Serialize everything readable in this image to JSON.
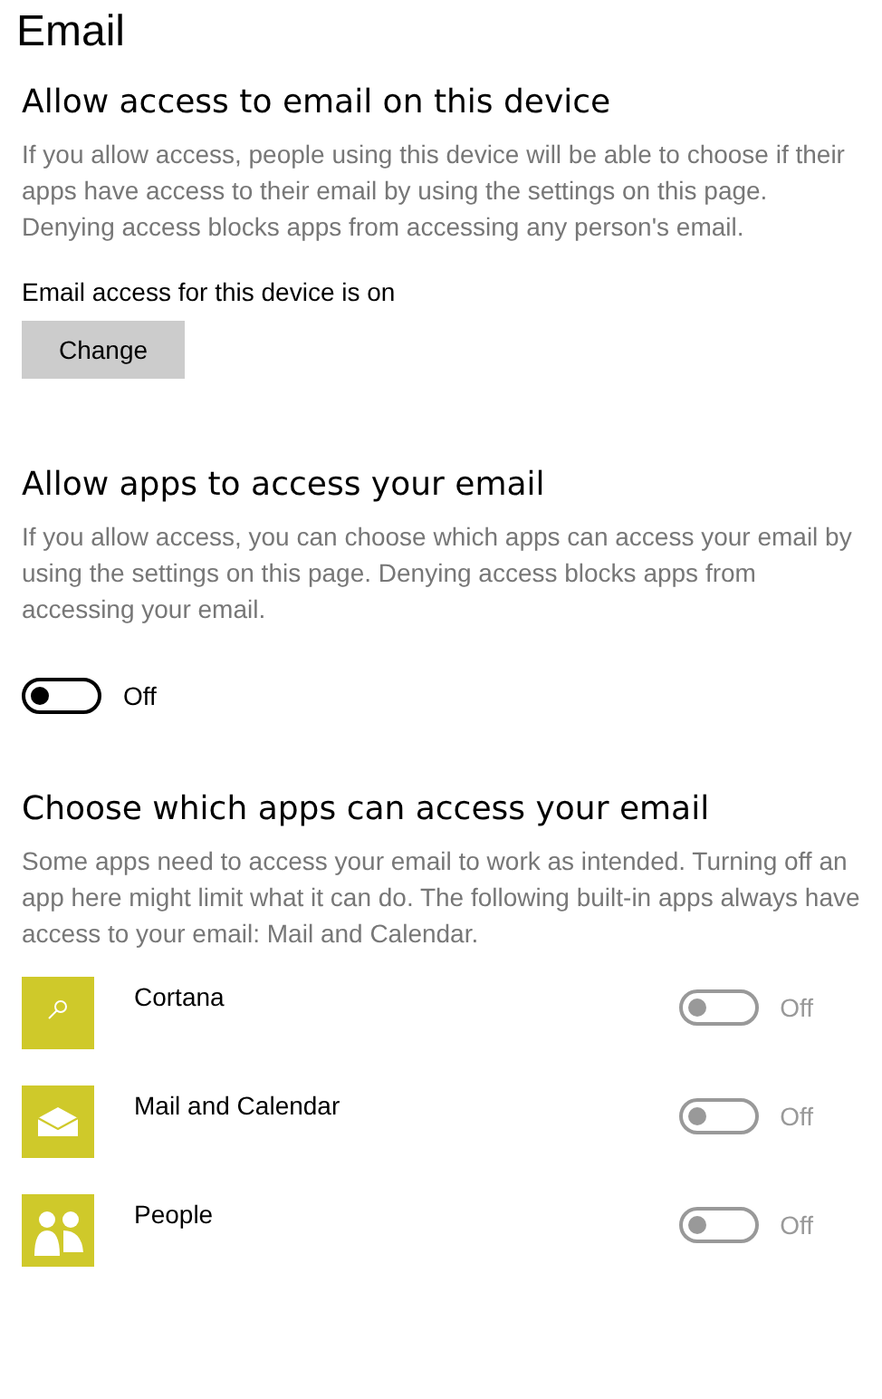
{
  "title": "Email",
  "device_access": {
    "heading": "Allow access to email on this device",
    "description": "If you allow access, people using this device will be able to choose if their apps have access to their email by using the settings on this page. Denying access blocks apps from accessing any person's email.",
    "status": "Email access for this device is on",
    "button": "Change"
  },
  "app_access": {
    "heading": "Allow apps to access your email",
    "description": "If you allow access, you can choose which apps can access your email by using the settings on this page. Denying access blocks apps from accessing your email.",
    "toggle": {
      "on": false,
      "label": "Off"
    }
  },
  "choose_apps": {
    "heading": "Choose which apps can access your email",
    "description": "Some apps need to access your email to work as intended. Turning off an app here might limit what it can do. The following built-in apps always have access to your email: Mail and Calendar.",
    "apps": [
      {
        "name": "Cortana",
        "on": false,
        "disabled": true,
        "label": "Off"
      },
      {
        "name": "Mail and Calendar",
        "on": false,
        "disabled": true,
        "label": "Off"
      },
      {
        "name": "People",
        "on": false,
        "disabled": true,
        "label": "Off"
      }
    ]
  }
}
